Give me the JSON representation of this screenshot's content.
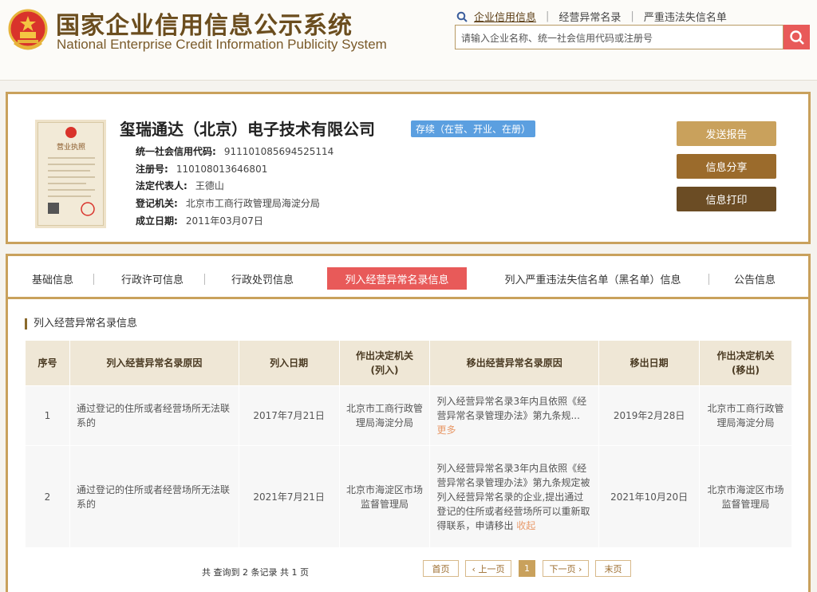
{
  "site": {
    "title": "国家企业信用信息公示系统",
    "subtitle": "National Enterprise Credit Information Publicity System"
  },
  "topnav": {
    "items": [
      "企业信用信息",
      "经营异常名录",
      "严重违法失信名单"
    ]
  },
  "search": {
    "placeholder": "请输入企业名称、统一社会信用代码或注册号"
  },
  "company": {
    "name": "玺瑞通达（北京）电子技术有限公司",
    "status": "存续（在营、开业、在册）",
    "fields": [
      {
        "label": "统一社会信用代码:",
        "value": "911101085694525114"
      },
      {
        "label": "注册号:",
        "value": "110108013646801"
      },
      {
        "label": "法定代表人:",
        "value": "王德山"
      },
      {
        "label": "登记机关:",
        "value": "北京市工商行政管理局海淀分局"
      },
      {
        "label": "成立日期:",
        "value": "2011年03月07日"
      }
    ],
    "license_label": "营业执照"
  },
  "actions": {
    "report": "发送报告",
    "share": "信息分享",
    "print": "信息打印"
  },
  "tabs": [
    "基础信息",
    "行政许可信息",
    "行政处罚信息",
    "列入经营异常名录信息",
    "列入严重违法失信名单（黑名单）信息",
    "公告信息"
  ],
  "section_title": "列入经营异常名录信息",
  "table": {
    "headers": [
      "序号",
      "列入经营异常名录原因",
      "列入日期",
      "作出决定机关\n(列入)",
      "移出经营异常名录原因",
      "移出日期",
      "作出决定机关\n(移出)"
    ],
    "rows": [
      {
        "no": "1",
        "reason": "通过登记的住所或者经营场所无法联系的",
        "date_in": "2017年7月21日",
        "authority_in": "北京市工商行政管理局海淀分局",
        "remove_reason": "列入经营异常名录3年内且依照《经营异常名录管理办法》第九条规...",
        "remove_link": "更多",
        "date_out": "2019年2月28日",
        "authority_out": "北京市工商行政管理局海淀分局"
      },
      {
        "no": "2",
        "reason": "通过登记的住所或者经营场所无法联系的",
        "date_in": "2021年7月21日",
        "authority_in": "北京市海淀区市场监督管理局",
        "remove_reason": "列入经营异常名录3年内且依照《经营异常名录管理办法》第九条规定被列入经营异常名录的企业,提出通过登记的住所或者经营场所可以重新取得联系，申请移出",
        "remove_link": "收起",
        "date_out": "2021年10月20日",
        "authority_out": "北京市海淀区市场监督管理局"
      }
    ]
  },
  "pagination": {
    "summary": "共 查询到 2 条记录 共 1 页",
    "first": "首页",
    "prev": "‹ 上一页",
    "current": "1",
    "next": "下一页 ›",
    "last": "末页"
  },
  "colors": {
    "brand_gold": "#c9a15c",
    "active_red": "#e85a59",
    "status_blue": "#5b9fe0"
  }
}
